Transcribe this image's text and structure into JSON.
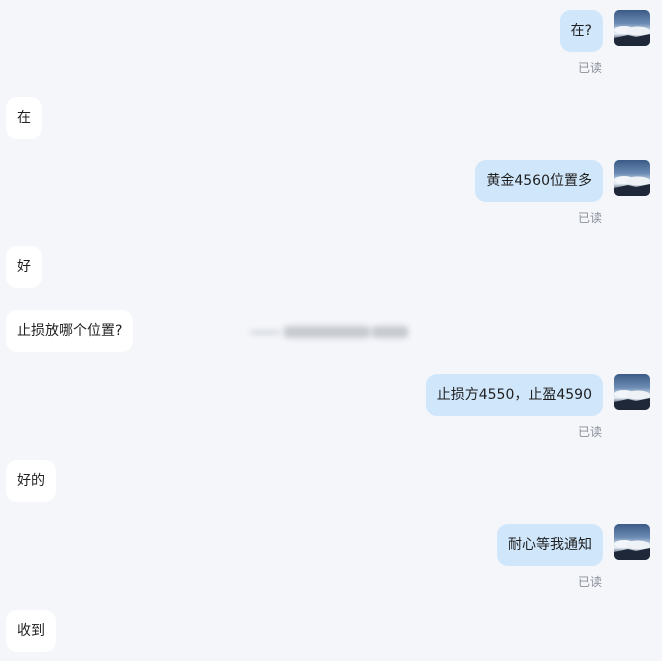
{
  "conversation": {
    "messages": [
      {
        "side": "out",
        "text": "在?",
        "status": "已读"
      },
      {
        "side": "in",
        "text": "在"
      },
      {
        "side": "out",
        "text": "黄金4560位置多",
        "status": "已读"
      },
      {
        "side": "in",
        "text": "好"
      },
      {
        "side": "in",
        "text": "止损放哪个位置?"
      },
      {
        "side": "out",
        "text": "止损方4550，止盈4590",
        "status": "已读"
      },
      {
        "side": "in",
        "text": "好的"
      },
      {
        "side": "out",
        "text": "耐心等我通知",
        "status": "已读"
      },
      {
        "side": "in",
        "text": "收到"
      }
    ]
  },
  "colors": {
    "background": "#f4f6fa",
    "incoming_bubble": "#ffffff",
    "outgoing_bubble": "#cfe6fb",
    "read_status": "#8a8f98"
  },
  "icons": {
    "avatar": "sky-clouds-avatar-icon"
  }
}
